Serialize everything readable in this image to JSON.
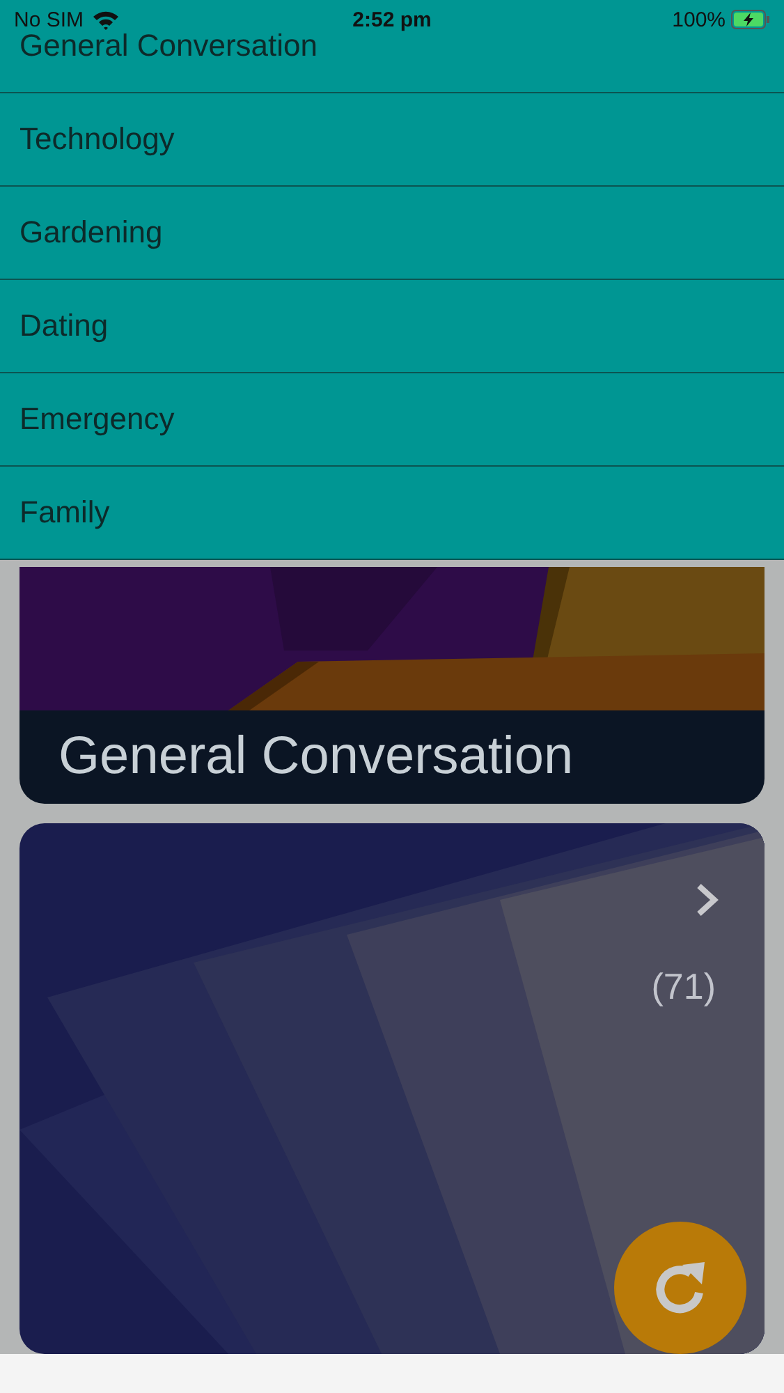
{
  "status_bar": {
    "carrier": "No SIM",
    "time": "2:52 pm",
    "battery": "100%"
  },
  "menu": [
    {
      "label": "General Conversation"
    },
    {
      "label": "Technology"
    },
    {
      "label": "Gardening"
    },
    {
      "label": "Dating"
    },
    {
      "label": "Emergency"
    },
    {
      "label": "Family"
    }
  ],
  "cards": [
    {
      "title": "General Conversation"
    },
    {
      "count": "(71)"
    }
  ]
}
